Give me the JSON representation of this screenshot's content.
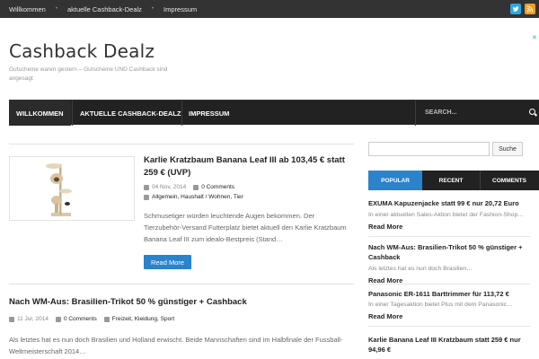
{
  "topbar": {
    "items": [
      "Willkommen",
      "aktuelle Cashback-Dealz",
      "Impressum"
    ],
    "separator": "•",
    "social": [
      "twitter-icon",
      "rss-icon"
    ]
  },
  "header": {
    "title": "Cashback Dealz",
    "tagline": "Gutscheine waren gestern – Gutscheine UND Cashback sind angesagt"
  },
  "nav": {
    "items": [
      "WILLKOMMEN",
      "AKTUELLE CASHBACK-DEALZ",
      "IMPRESSUM"
    ],
    "search_placeholder": "SEARCH..."
  },
  "posts": [
    {
      "title": "Karlie Kratzbaum Banana Leaf III ab 103,45 € statt 259 € (UVP)",
      "date": "04 Nov, 2014",
      "comments": "0 Comments",
      "categories": "Allgemein, Haushalt / Wohnen, Tier",
      "excerpt": "Schmusetiger würden leuchtende Augen bekommen. Der Tierzubehör-Versand Futterplatz bietet aktuell den Karlie Kratzbaum Banana Leaf III zum idealo-Bestpreis (Stand…",
      "read_more": "Read More"
    },
    {
      "title": "Nach WM-Aus: Brasilien-Trikot 50 % günstiger + Cashback",
      "date": "11 Jul, 2014",
      "comments": "0 Comments",
      "categories": "Freizeit, Kleidung, Sport",
      "excerpt": "Als letztes hat es nun doch Brasilien und Holland erwischt. Beide Mannschaften sind im Halbfinale der Fussball-Weltmeisterschaft 2014…"
    }
  ],
  "sidebar": {
    "search_button": "Suche",
    "tabs": [
      "POPULAR",
      "RECENT",
      "COMMENTS"
    ],
    "items": [
      {
        "title": "EXUMA Kapuzenjacke statt 99 € nur 20,72 Euro",
        "excerpt": "In einer aktuellen Sales-Aktion bietet der Fashion-Shop…",
        "read_more": "Read More"
      },
      {
        "title": "Nach WM-Aus: Brasilien-Trikot 50 % günstiger + Cashback",
        "excerpt": "Als letztes hat es nun doch Brasilien…",
        "read_more": "Read More"
      },
      {
        "title": "Panasonic ER-1611 Barttrimmer für 113,72 €",
        "excerpt": "In einer Tagesaktion bietet Plus mit dem Panasonic…",
        "read_more": "Read More"
      },
      {
        "title": "Karlie Banana Leaf III Kratzbaum statt 259 € nur 94,96 €",
        "excerpt": "",
        "read_more": ""
      }
    ]
  },
  "colors": {
    "accent": "#2a83cb",
    "topbar": "#333333",
    "nav": "#222222",
    "twitter": "#29a9e1",
    "rss": "#f39d1f"
  }
}
